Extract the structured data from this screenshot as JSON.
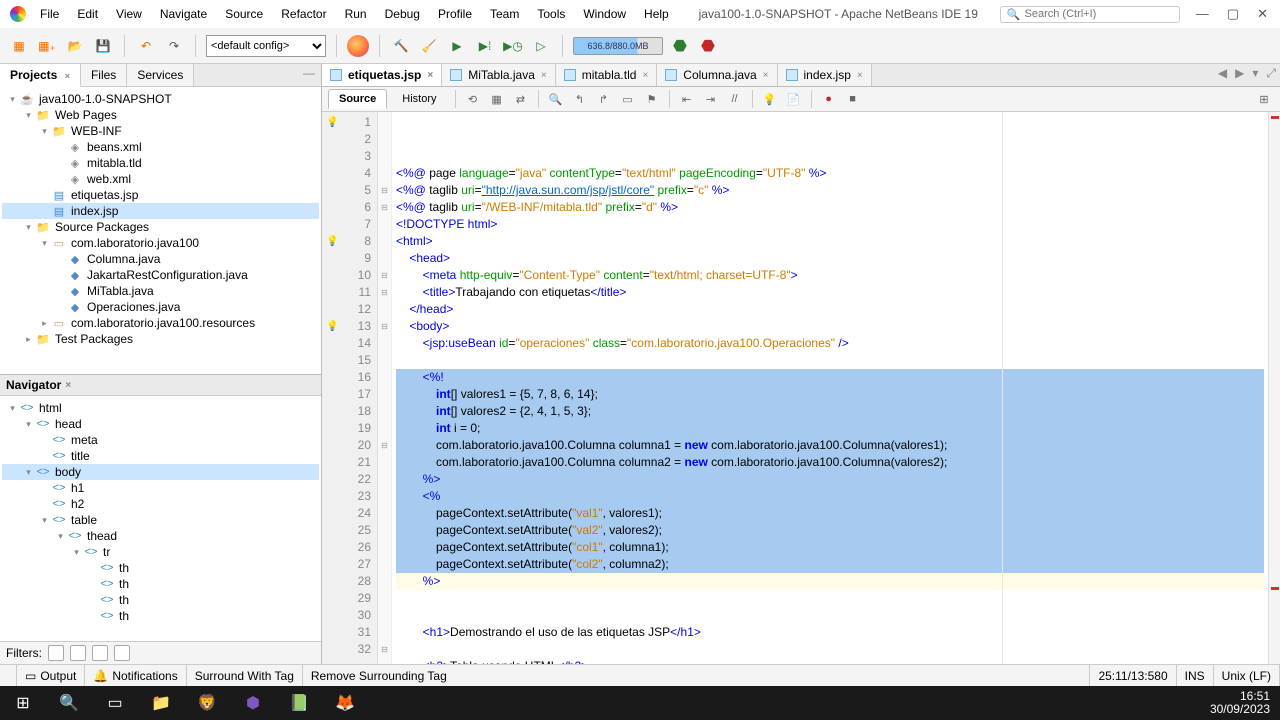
{
  "titlebar": {
    "title": "java100-1.0-SNAPSHOT - Apache NetBeans IDE 19",
    "search_placeholder": "Search (Ctrl+I)"
  },
  "menu": [
    "File",
    "Edit",
    "View",
    "Navigate",
    "Source",
    "Refactor",
    "Run",
    "Debug",
    "Profile",
    "Team",
    "Tools",
    "Window",
    "Help"
  ],
  "toolbar": {
    "config": "<default config>",
    "memory": "636.8/880.0MB"
  },
  "projects_panel": {
    "tabs": [
      "Projects",
      "Files",
      "Services"
    ],
    "tree": [
      {
        "d": 0,
        "tw": "▾",
        "ic": "☕",
        "cls": "ico-java",
        "label": "java100-1.0-SNAPSHOT"
      },
      {
        "d": 1,
        "tw": "▾",
        "ic": "📁",
        "cls": "ico-folder",
        "label": "Web Pages"
      },
      {
        "d": 2,
        "tw": "▾",
        "ic": "📁",
        "cls": "ico-folder",
        "label": "WEB-INF"
      },
      {
        "d": 3,
        "tw": "",
        "ic": "◈",
        "cls": "ico-xml",
        "label": "beans.xml"
      },
      {
        "d": 3,
        "tw": "",
        "ic": "◈",
        "cls": "ico-xml",
        "label": "mitabla.tld"
      },
      {
        "d": 3,
        "tw": "",
        "ic": "◈",
        "cls": "ico-xml",
        "label": "web.xml"
      },
      {
        "d": 2,
        "tw": "",
        "ic": "▤",
        "cls": "ico-html",
        "label": "etiquetas.jsp"
      },
      {
        "d": 2,
        "tw": "",
        "ic": "▤",
        "cls": "ico-html",
        "label": "index.jsp",
        "sel": true
      },
      {
        "d": 1,
        "tw": "▾",
        "ic": "📁",
        "cls": "ico-folder",
        "label": "Source Packages"
      },
      {
        "d": 2,
        "tw": "▾",
        "ic": "▭",
        "cls": "ico-pkg",
        "label": "com.laboratorio.java100"
      },
      {
        "d": 3,
        "tw": "",
        "ic": "◆",
        "cls": "ico-java",
        "label": "Columna.java"
      },
      {
        "d": 3,
        "tw": "",
        "ic": "◆",
        "cls": "ico-java",
        "label": "JakartaRestConfiguration.java"
      },
      {
        "d": 3,
        "tw": "",
        "ic": "◆",
        "cls": "ico-java",
        "label": "MiTabla.java"
      },
      {
        "d": 3,
        "tw": "",
        "ic": "◆",
        "cls": "ico-java",
        "label": "Operaciones.java"
      },
      {
        "d": 2,
        "tw": "▸",
        "ic": "▭",
        "cls": "ico-pkg",
        "label": "com.laboratorio.java100.resources"
      },
      {
        "d": 1,
        "tw": "▸",
        "ic": "📁",
        "cls": "ico-folder",
        "label": "Test Packages"
      }
    ]
  },
  "navigator": {
    "title": "Navigator",
    "tree": [
      {
        "d": 0,
        "tw": "▾",
        "ic": "<>",
        "label": "html"
      },
      {
        "d": 1,
        "tw": "▾",
        "ic": "<>",
        "label": "head"
      },
      {
        "d": 2,
        "tw": "",
        "ic": "<>",
        "label": "meta"
      },
      {
        "d": 2,
        "tw": "",
        "ic": "<>",
        "label": "title"
      },
      {
        "d": 1,
        "tw": "▾",
        "ic": "<>",
        "label": "body",
        "sel": true
      },
      {
        "d": 2,
        "tw": "",
        "ic": "<>",
        "label": "h1"
      },
      {
        "d": 2,
        "tw": "",
        "ic": "<>",
        "label": "h2"
      },
      {
        "d": 2,
        "tw": "▾",
        "ic": "<>",
        "label": "table"
      },
      {
        "d": 3,
        "tw": "▾",
        "ic": "<>",
        "label": "thead"
      },
      {
        "d": 4,
        "tw": "▾",
        "ic": "<>",
        "label": "tr"
      },
      {
        "d": 5,
        "tw": "",
        "ic": "<>",
        "label": "th"
      },
      {
        "d": 5,
        "tw": "",
        "ic": "<>",
        "label": "th"
      },
      {
        "d": 5,
        "tw": "",
        "ic": "<>",
        "label": "th"
      },
      {
        "d": 5,
        "tw": "",
        "ic": "<>",
        "label": "th"
      }
    ],
    "filters_label": "Filters:"
  },
  "editor_tabs": [
    {
      "label": "etiquetas.jsp",
      "active": true
    },
    {
      "label": "MiTabla.java"
    },
    {
      "label": "mitabla.tld"
    },
    {
      "label": "Columna.java"
    },
    {
      "label": "index.jsp"
    }
  ],
  "editor_modes": {
    "source": "Source",
    "history": "History"
  },
  "code": {
    "line_start": 1,
    "line_end": 32,
    "selection_start": 13,
    "selection_end": 25
  },
  "statusbar": {
    "output": "Output",
    "notifications": "Notifications",
    "surround": "Surround With Tag",
    "remove_surround": "Remove Surrounding Tag",
    "pos": "25:11/13:580",
    "ins": "INS",
    "enc": "Unix (LF)"
  },
  "clock": {
    "time": "16:51",
    "date": "30/09/2023"
  }
}
